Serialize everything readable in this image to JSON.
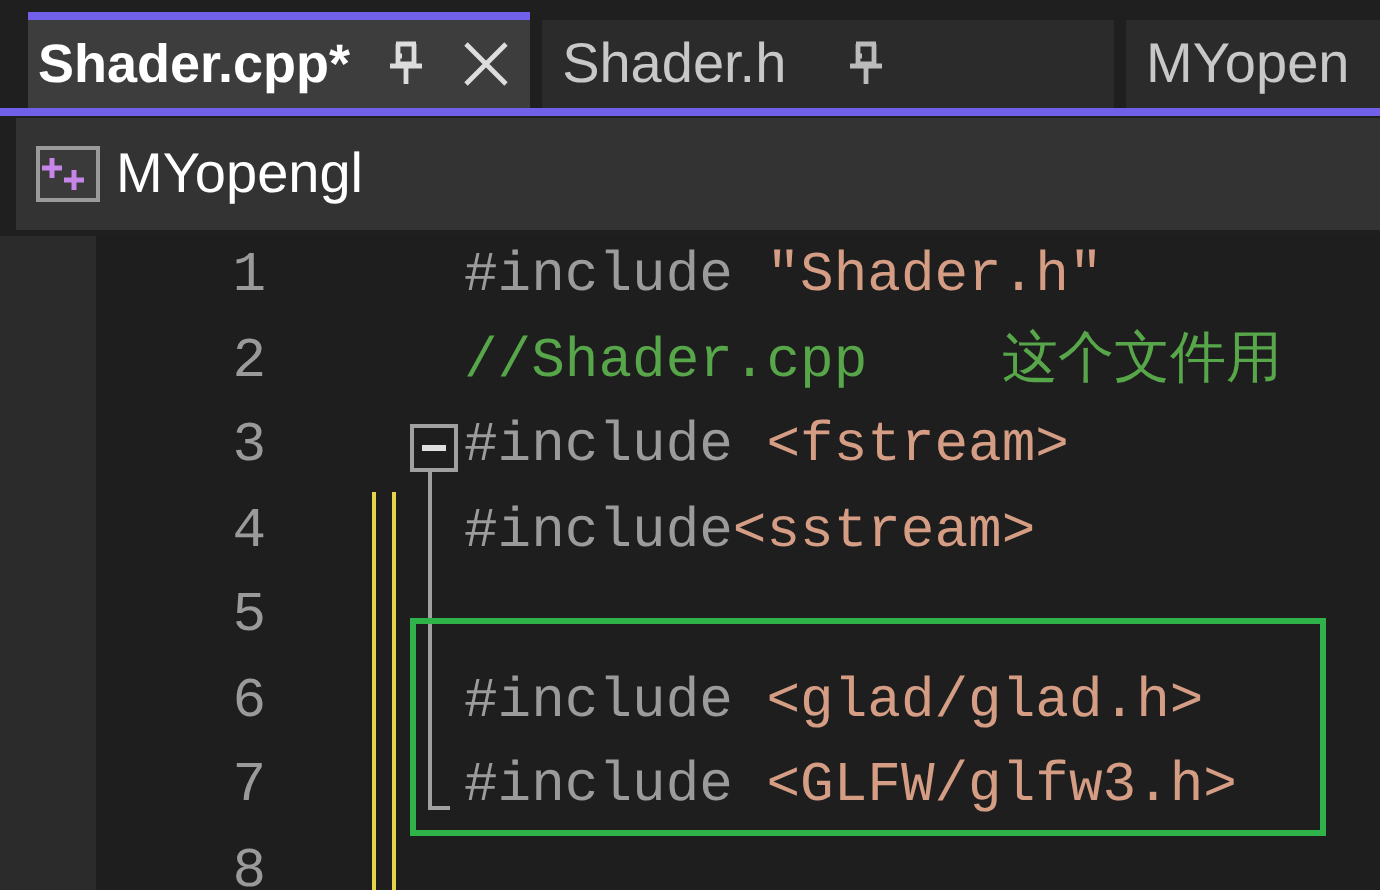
{
  "tabs": [
    {
      "label": "Shader.cpp*",
      "selected": true,
      "pinned": true
    },
    {
      "label": "Shader.h",
      "selected": false,
      "pinned": true
    },
    {
      "label": "MYopen",
      "selected": false,
      "pinned": false
    }
  ],
  "navigation_bar": {
    "project": "MYopengl"
  },
  "editor": {
    "lines": [
      {
        "number": "1",
        "changed": false,
        "boxed": false,
        "collapse_marker": false,
        "in_outline": false,
        "tokens": [
          {
            "kind": "directive",
            "text": "#include "
          },
          {
            "kind": "string",
            "text": "\"Shader.h\""
          }
        ]
      },
      {
        "number": "2",
        "changed": false,
        "boxed": false,
        "collapse_marker": false,
        "in_outline": false,
        "tokens": [
          {
            "kind": "comment",
            "text": "//Shader.cpp    这个文件用"
          }
        ]
      },
      {
        "number": "3",
        "changed": false,
        "boxed": false,
        "collapse_marker": true,
        "in_outline": false,
        "tokens": [
          {
            "kind": "directive",
            "text": "#include "
          },
          {
            "kind": "string",
            "text": "<fstream>"
          }
        ]
      },
      {
        "number": "4",
        "changed": true,
        "boxed": false,
        "collapse_marker": false,
        "in_outline": true,
        "tokens": [
          {
            "kind": "directive",
            "text": "#include"
          },
          {
            "kind": "string",
            "text": "<sstream>"
          }
        ]
      },
      {
        "number": "5",
        "changed": true,
        "boxed": false,
        "collapse_marker": false,
        "in_outline": true
      },
      {
        "number": "6",
        "changed": true,
        "boxed": true,
        "collapse_marker": false,
        "in_outline": true,
        "tokens": [
          {
            "kind": "directive",
            "text": "#include "
          },
          {
            "kind": "string",
            "text": "<glad/glad.h>"
          }
        ]
      },
      {
        "number": "7",
        "changed": true,
        "boxed": true,
        "collapse_marker": false,
        "in_outline": true,
        "tokens": [
          {
            "kind": "directive",
            "text": "#include "
          },
          {
            "kind": "string",
            "text": "<GLFW/glfw3.h>"
          }
        ]
      },
      {
        "number": "8",
        "changed": true,
        "boxed": false,
        "collapse_marker": false,
        "in_outline": false
      }
    ]
  }
}
